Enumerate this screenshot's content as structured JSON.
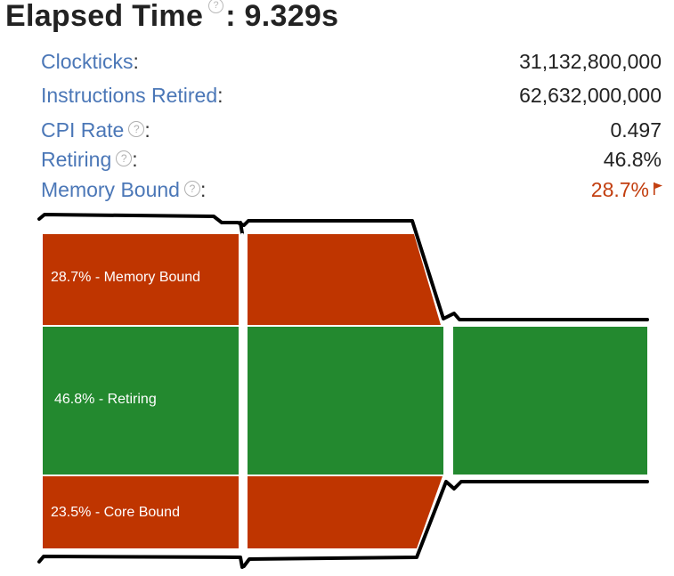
{
  "header": {
    "title": "Elapsed Time",
    "help_glyph": "?",
    "value": ": 9.329s"
  },
  "metrics": [
    {
      "label": "Clockticks",
      "value": "31,132,800,000",
      "has_help": false
    },
    {
      "label": "Instructions Retired",
      "value": "62,632,000,000",
      "has_help": false
    },
    {
      "label": "CPI Rate",
      "value": "0.497",
      "has_help": true
    },
    {
      "label": "Retiring",
      "value": "46.8%",
      "has_help": true
    },
    {
      "label": "Memory Bound",
      "value": "28.7%",
      "has_help": true,
      "flagged": true
    }
  ],
  "colon": ":",
  "diagram": {
    "segments": [
      {
        "label": "28.7% - Memory Bound",
        "percent": 28.7,
        "color": "#bf3500"
      },
      {
        "label": "46.8% - Retiring",
        "percent": 46.8,
        "color": "#23892f"
      },
      {
        "label": "23.5% - Core Bound",
        "percent": 23.5,
        "color": "#bf3500"
      }
    ]
  },
  "colors": {
    "label": "#4b77b7",
    "flag": "#c23e0f",
    "red_segment": "#bf3500",
    "green_segment": "#23892f"
  }
}
